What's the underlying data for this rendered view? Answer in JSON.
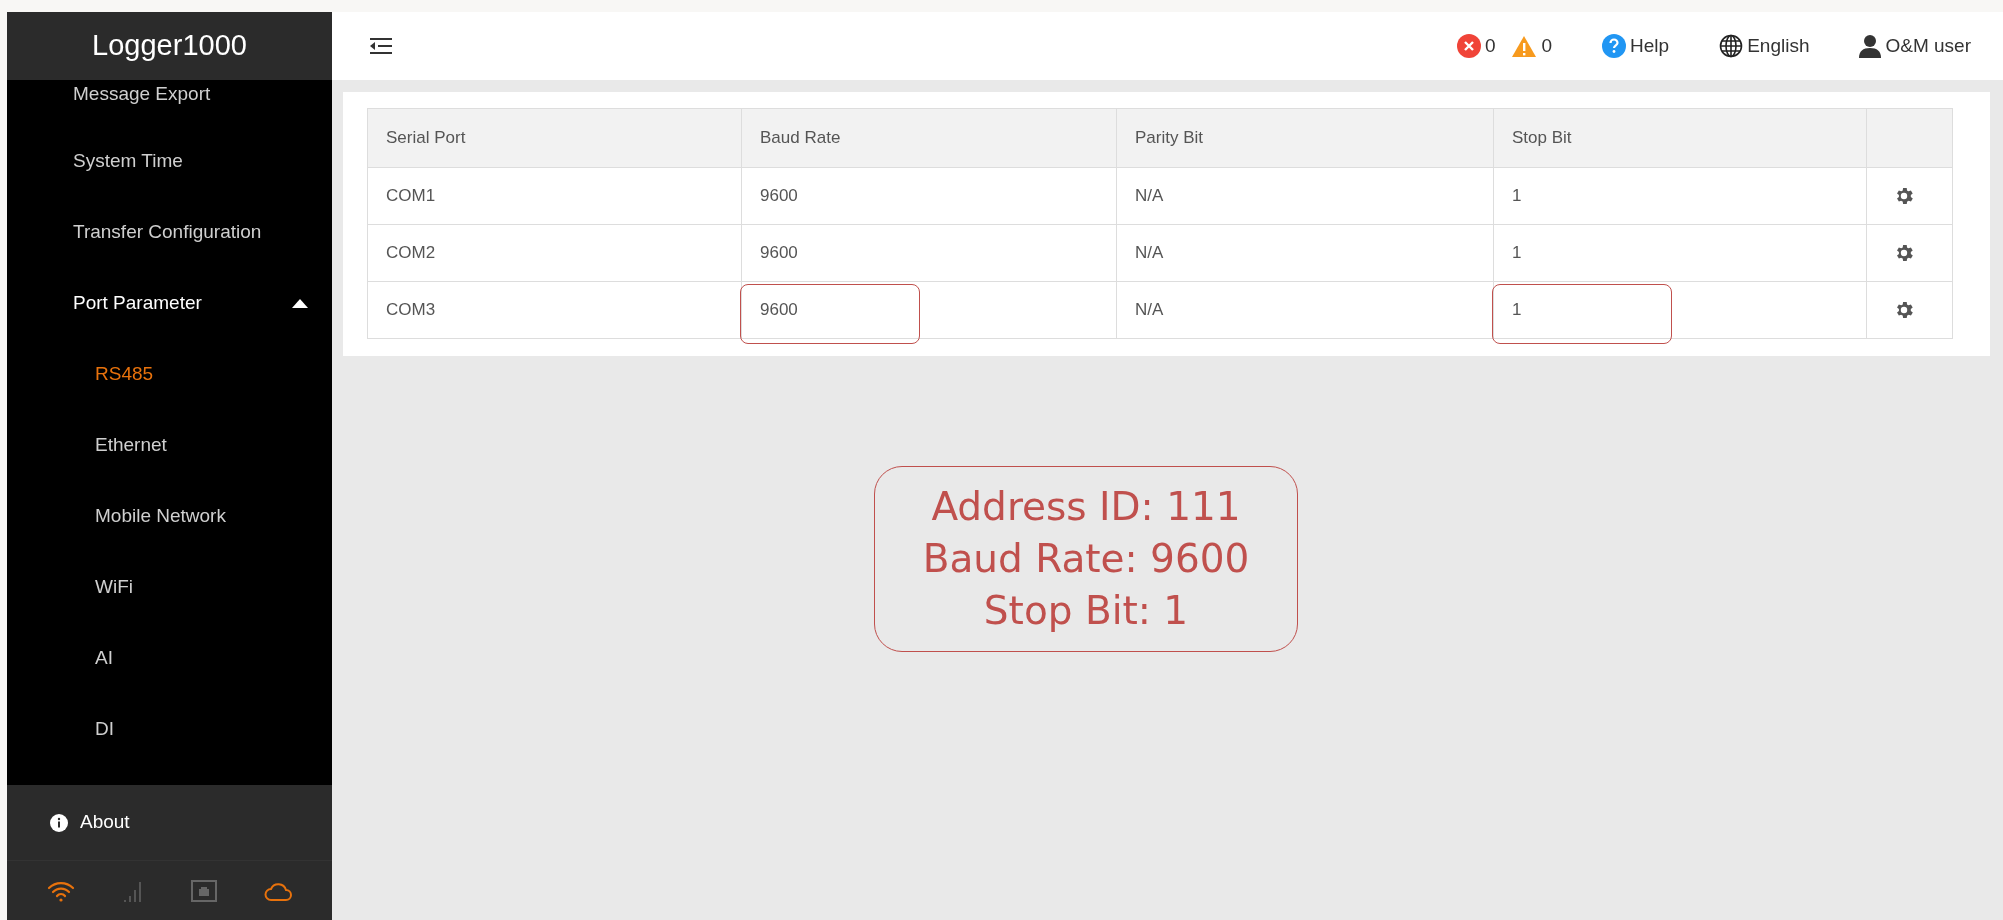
{
  "sidebar": {
    "title": "Logger1000",
    "items": [
      {
        "label": "Message Export",
        "selected": false
      },
      {
        "label": "System Time",
        "selected": false
      },
      {
        "label": "Transfer Configuration",
        "selected": false
      },
      {
        "label": "Port Parameter",
        "selected": false,
        "expanded": true,
        "children": [
          {
            "label": "RS485",
            "selected": true
          },
          {
            "label": "Ethernet",
            "selected": false
          },
          {
            "label": "Mobile Network",
            "selected": false
          },
          {
            "label": "WiFi",
            "selected": false
          },
          {
            "label": "AI",
            "selected": false
          },
          {
            "label": "DI",
            "selected": false
          }
        ]
      }
    ],
    "about": "About"
  },
  "topbar": {
    "errors": "0",
    "warnings": "0",
    "help": "Help",
    "language": "English",
    "user": "O&M user"
  },
  "table": {
    "columns": [
      "Serial Port",
      "Baud Rate",
      "Parity Bit",
      "Stop Bit"
    ],
    "rows": [
      {
        "cells": [
          {
            "text": "COM1",
            "highlighted": false
          },
          {
            "text": "9600",
            "highlighted": false
          },
          {
            "text": "N/A",
            "highlighted": false
          },
          {
            "text": "1",
            "highlighted": false
          }
        ]
      },
      {
        "cells": [
          {
            "text": "COM2",
            "highlighted": false
          },
          {
            "text": "9600",
            "highlighted": false
          },
          {
            "text": "N/A",
            "highlighted": false
          },
          {
            "text": "1",
            "highlighted": false
          }
        ]
      },
      {
        "cells": [
          {
            "text": "COM3",
            "highlighted": false
          },
          {
            "text": "9600",
            "highlighted": true
          },
          {
            "text": "N/A",
            "highlighted": false
          },
          {
            "text": "1",
            "highlighted": true
          }
        ]
      }
    ]
  },
  "annotation": [
    "Address ID: 111",
    "Baud Rate: 9600",
    "Stop Bit: 1"
  ]
}
